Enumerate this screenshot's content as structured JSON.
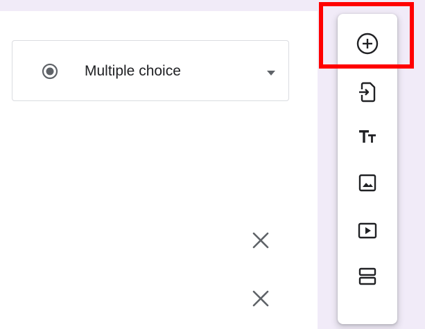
{
  "question": {
    "type_label": "Multiple choice",
    "type_icon": "radio-checked-icon",
    "dropdown_icon": "arrow-drop-down-icon"
  },
  "options": {
    "remove_icon": "close-icon",
    "remove_count": 2
  },
  "toolbar": {
    "items": [
      {
        "name": "add-question",
        "icon": "add-circle-icon"
      },
      {
        "name": "import-questions",
        "icon": "import-icon"
      },
      {
        "name": "add-title-description",
        "icon": "title-icon",
        "glyph": "Tт"
      },
      {
        "name": "add-image",
        "icon": "image-icon"
      },
      {
        "name": "add-video",
        "icon": "video-icon"
      },
      {
        "name": "add-section",
        "icon": "section-icon"
      }
    ]
  },
  "highlight": {
    "target": "add-question",
    "color": "#ff0000"
  },
  "colors": {
    "icon": "#5f6368",
    "text": "#202124",
    "border": "#dadce0",
    "page_background": "#f1ebf8"
  }
}
